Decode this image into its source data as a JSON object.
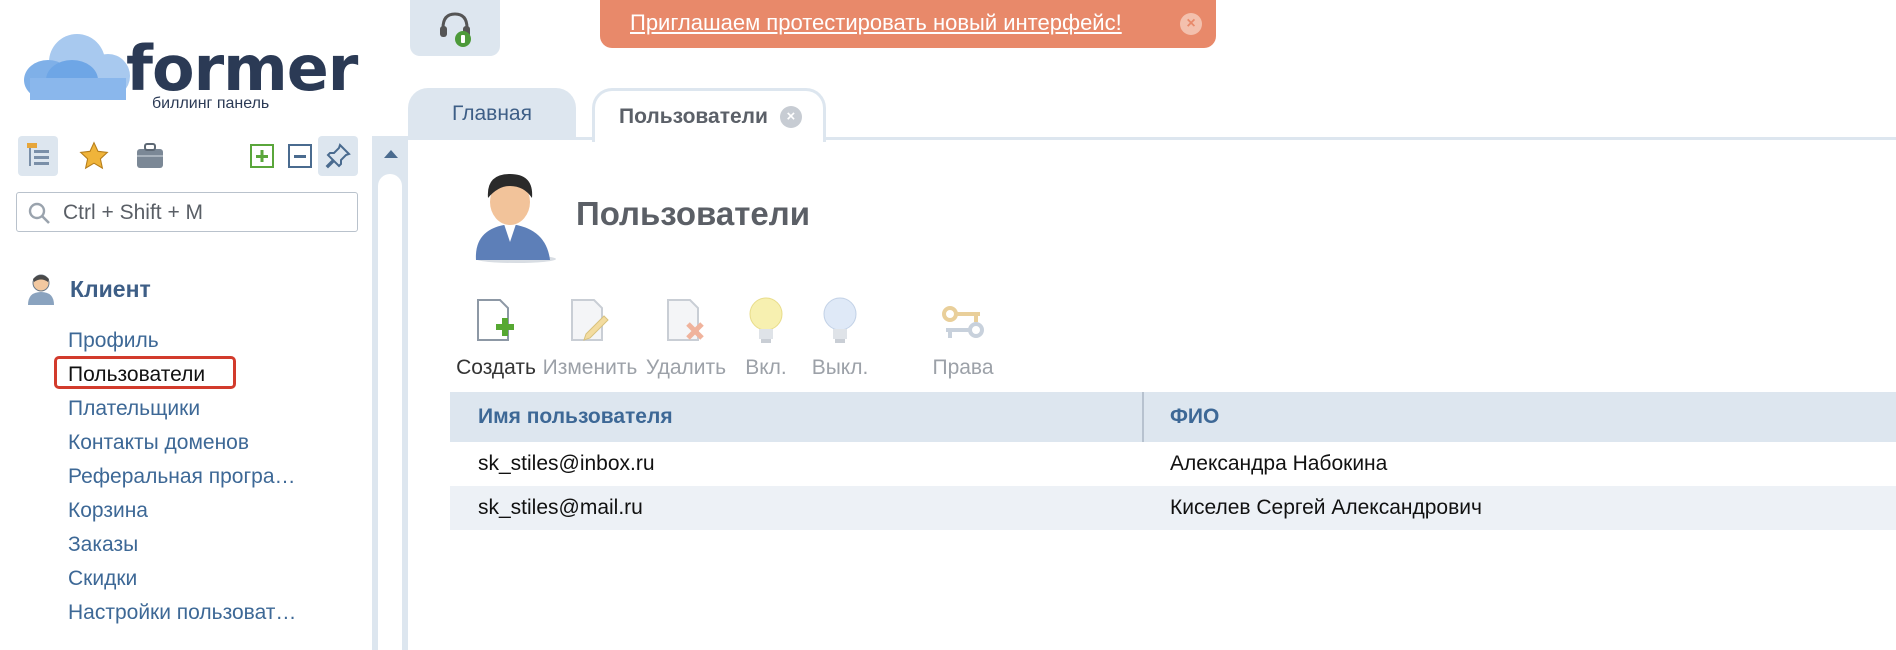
{
  "logo": {
    "word": "former",
    "subtitle": "биллинг панель"
  },
  "search": {
    "placeholder": "Ctrl + Shift + M"
  },
  "nav": {
    "section": "Клиент",
    "items": [
      "Профиль",
      "Пользователи",
      "Плательщики",
      "Контакты доменов",
      "Реферальная програ…",
      "Корзина",
      "Заказы",
      "Скидки",
      "Настройки пользоват…"
    ],
    "selected": "Пользователи"
  },
  "banner": {
    "text": "Приглашаем протестировать новый интерфейс!",
    "close": "×"
  },
  "tabs": {
    "main": "Главная",
    "users": "Пользователи",
    "close": "×"
  },
  "page": {
    "title": "Пользователи"
  },
  "toolbar": {
    "create": "Создать",
    "edit": "Изменить",
    "delete": "Удалить",
    "enable": "Вкл.",
    "disable": "Выкл.",
    "rights": "Права"
  },
  "table": {
    "columns": [
      "Имя пользователя",
      "ФИО"
    ],
    "rows": [
      [
        "sk_stiles@inbox.ru",
        "Александра Набокина"
      ],
      [
        "sk_stiles@mail.ru",
        "Киселев Сергей Александрович"
      ]
    ]
  },
  "colors": {
    "accent": "#3d6896",
    "banner": "#e8896a",
    "highlight": "#d23b2c",
    "panel": "#dde6ef"
  }
}
